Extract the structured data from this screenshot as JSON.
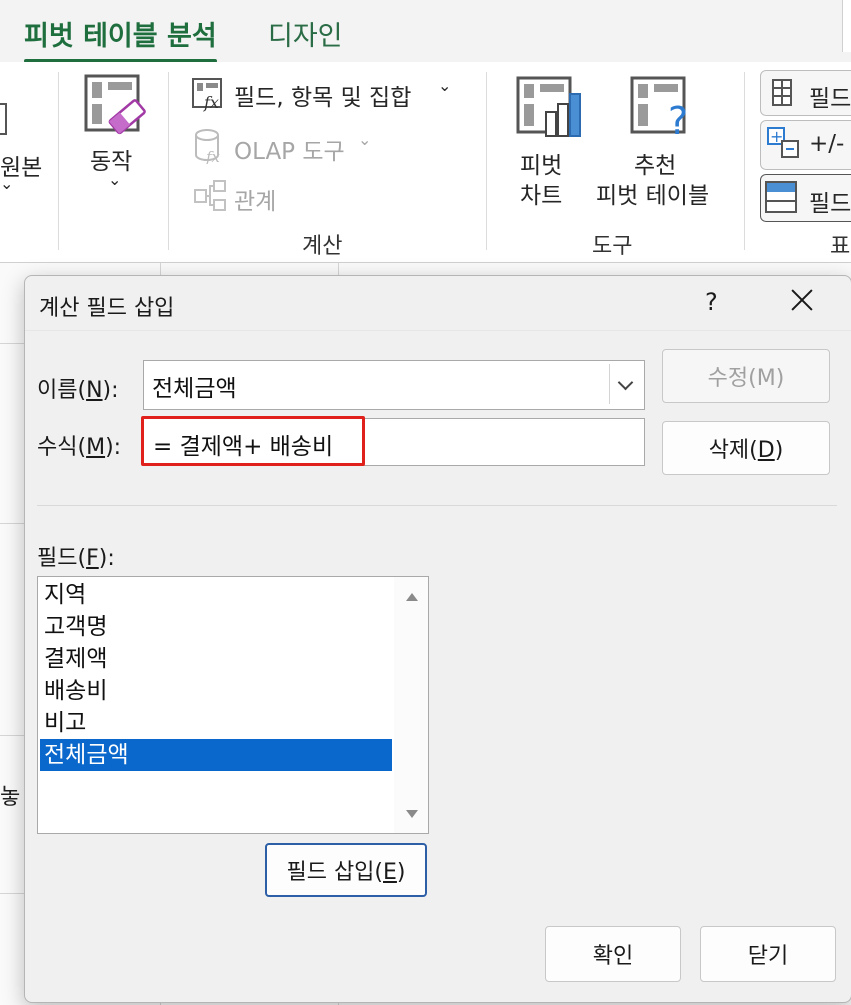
{
  "ribbon": {
    "tabs": [
      {
        "label": "피벗 테이블 분석",
        "active": true
      },
      {
        "label": "디자인",
        "active": false
      }
    ],
    "left_partial_label": "원본",
    "action_label": "동작",
    "calc_items": [
      {
        "label": "필드, 항목 및 집합",
        "enabled": true
      },
      {
        "label": "OLAP 도구",
        "enabled": false
      },
      {
        "label": "관계",
        "enabled": false
      }
    ],
    "calc_group_label": "계산",
    "pivot_chart_line1": "피벗",
    "pivot_chart_line2": "차트",
    "recommended_line1": "추천",
    "recommended_line2": "피벗 테이블",
    "tools_group_label": "도구",
    "right_items": [
      "필드",
      "+/-",
      "필드"
    ],
    "right_group_partial": "표"
  },
  "sheet": {
    "partial_cell_text": "놓"
  },
  "dialog": {
    "title": "계산 필드 삽입",
    "help": "?",
    "name_label": "이름(",
    "name_key": "N",
    "name_label_end": "):",
    "name_value": "전체금액",
    "formula_label": "수식(",
    "formula_key": "M",
    "formula_label_end": "):",
    "formula_value": "= 결제액+ 배송비",
    "modify_button": "수정(M)",
    "delete_button_text": "삭제(",
    "delete_button_key": "D",
    "delete_button_end": ")",
    "fields_label": "필드(",
    "fields_key": "F",
    "fields_label_end": "):",
    "fields": [
      "지역",
      "고객명",
      "결제액",
      "배송비",
      "비고",
      "전체금액"
    ],
    "selected_field": "전체금액",
    "insert_field_text": "필드 삽입(",
    "insert_field_key": "E",
    "insert_field_end": ")",
    "ok_button": "확인",
    "close_button": "닫기",
    "colors": {
      "selection": "#0a68cc",
      "highlight_border": "#e0201b",
      "tab_active": "#1e6e3e"
    }
  }
}
